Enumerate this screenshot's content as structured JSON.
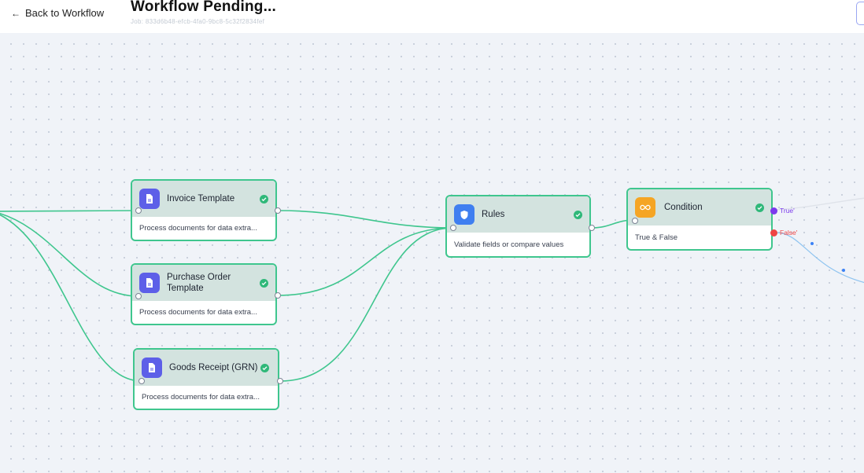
{
  "header": {
    "back_label": "Back to Workflow",
    "title": "Workflow Pending...",
    "job_id": "Job: 833d6b48-efcb-4fa0-9bc8-5c32f2834fef"
  },
  "nodes": {
    "invoice": {
      "title": "Invoice Template",
      "desc": "Process documents for data extra...",
      "icon": "document-icon",
      "color": "#5d5fe8"
    },
    "purchase_order": {
      "title": "Purchase Order Template",
      "desc": "Process documents for data extra...",
      "icon": "document-icon",
      "color": "#5d5fe8"
    },
    "goods_receipt": {
      "title": "Goods Receipt (GRN)",
      "desc": "Process documents for data extra...",
      "icon": "document-icon",
      "color": "#5d5fe8"
    },
    "rules": {
      "title": "Rules",
      "desc": "Validate fields or compare values",
      "icon": "shield-icon",
      "color": "#3f7ff0"
    },
    "condition": {
      "title": "Condition",
      "desc": "True & False",
      "icon": "infinity-icon",
      "color": "#f5a524"
    }
  },
  "outputs": {
    "true_label": "True'",
    "false_label": "False'",
    "true_color": "#7c3aed",
    "false_color": "#ef4444"
  },
  "colors": {
    "edge": "#3fc68e",
    "node_border": "#3fc68e",
    "node_head": "#d3e3df",
    "canvas": "#f0f3f8"
  }
}
